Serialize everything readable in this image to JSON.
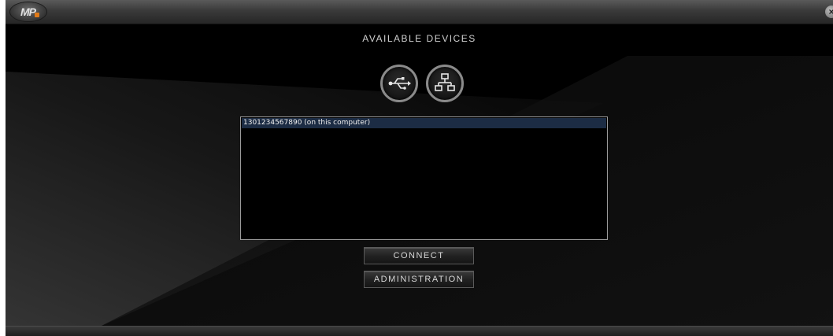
{
  "app": {
    "logo_text": "MP",
    "close_glyph": "×"
  },
  "main": {
    "heading": "AVAILABLE DEVICES",
    "connection_types": [
      {
        "name": "usb",
        "icon": "usb-icon"
      },
      {
        "name": "network",
        "icon": "network-icon"
      }
    ],
    "devices": [
      {
        "label": "1301234567890 (on this computer)",
        "selected": true
      }
    ],
    "connect_label": "CONNECT",
    "administration_label": "ADMINISTRATION"
  },
  "colors": {
    "selection": "#1c2c44",
    "accent": "#e07a18"
  }
}
